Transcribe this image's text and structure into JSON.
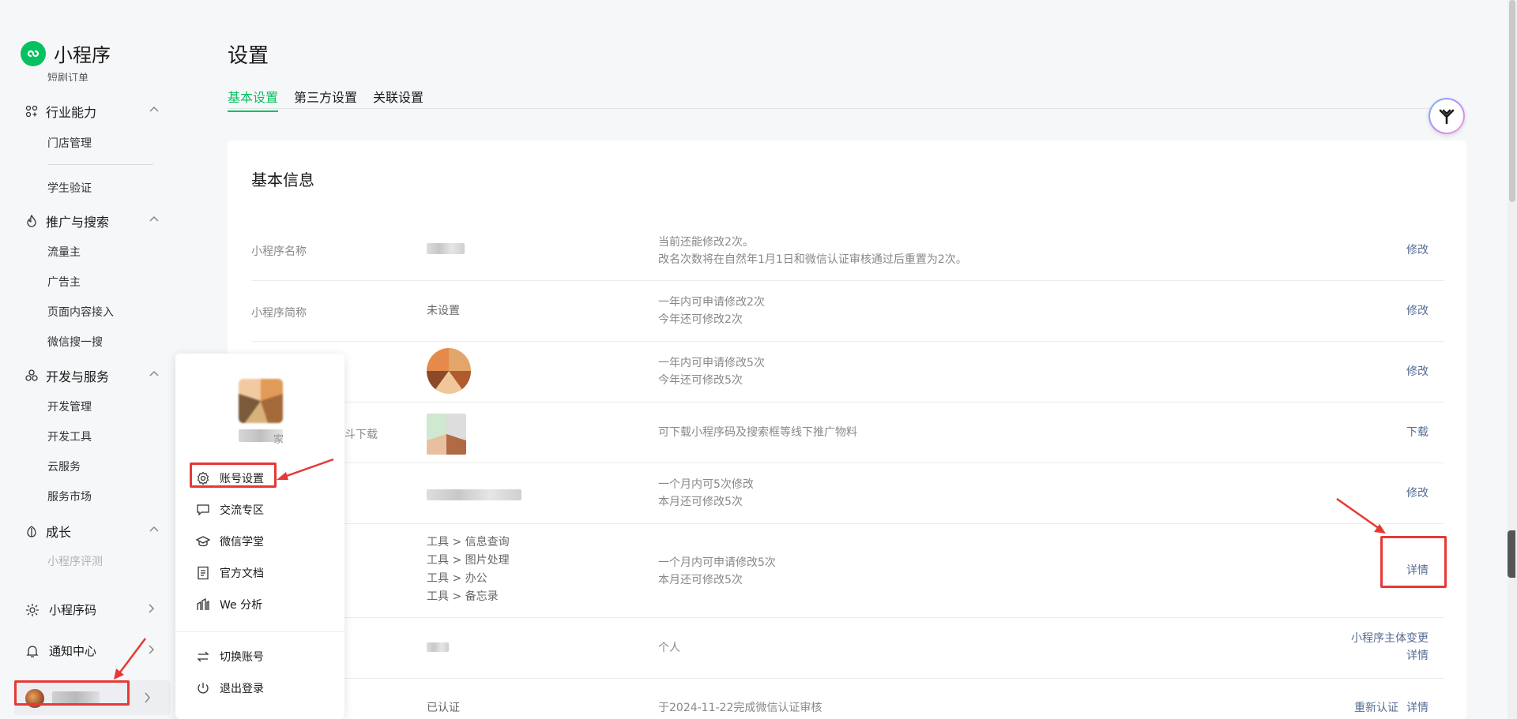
{
  "app": {
    "name": "小程序",
    "brand_color": "#07c160",
    "link_color": "#576b95",
    "alert_color": "#e53935"
  },
  "sidebar": {
    "cut_item": "短剧订单",
    "groups": [
      {
        "label": "行业能力",
        "icon": "industry-icon",
        "items": [
          "门店管理",
          "学生验证"
        ]
      },
      {
        "label": "推广与搜索",
        "icon": "flame-icon",
        "items": [
          "流量主",
          "广告主",
          "页面内容接入",
          "微信搜一搜"
        ]
      },
      {
        "label": "开发与服务",
        "icon": "cluster-icon",
        "items": [
          "开发管理",
          "开发工具",
          "云服务",
          "服务市场"
        ]
      },
      {
        "label": "成长",
        "icon": "leaf-icon",
        "items": [
          "小程序评测"
        ]
      }
    ],
    "rows": [
      {
        "label": "小程序码",
        "icon": "sun-icon"
      },
      {
        "label": "通知中心",
        "icon": "bell-icon"
      }
    ]
  },
  "page": {
    "title": "设置",
    "tabs": [
      "基本设置",
      "第三方设置",
      "关联设置"
    ]
  },
  "basic_info": {
    "title": "基本信息",
    "rows": [
      {
        "label": "小程序名称",
        "desc": [
          "当前还能修改2次。",
          "改名次数将在自然年1月1日和微信认证审核通过后重置为2次。"
        ],
        "action": "修改"
      },
      {
        "label": "小程序简称",
        "value": "未设置",
        "desc": [
          "一年内可申请修改2次",
          "今年还可修改2次"
        ],
        "action": "修改"
      },
      {
        "desc": [
          "一年内可申请修改5次",
          "今年还可修改5次"
        ],
        "action": "修改"
      },
      {
        "label_partial": "斗下载",
        "desc": [
          "可下载小程序码及搜索框等线下推广物料"
        ],
        "action": "下载"
      },
      {
        "desc": [
          "一个月内可5次修改",
          "本月还可修改5次"
        ],
        "action": "修改"
      },
      {
        "categories": [
          "工具 > 信息查询",
          "工具 > 图片处理",
          "工具 > 办公",
          "工具 > 备忘录"
        ],
        "desc": [
          "一个月内可申请修改5次",
          "本月还可修改5次"
        ],
        "action": "详情"
      },
      {
        "desc": [
          "个人"
        ],
        "actions": [
          "小程序主体变更",
          "详情"
        ]
      },
      {
        "value": "已认证",
        "desc": [
          "于2024-11-22完成微信认证审核"
        ],
        "actions": [
          "重新认证",
          "详情"
        ]
      }
    ]
  },
  "account_popup": {
    "name_partial": "家",
    "items": [
      {
        "label": "账号设置",
        "icon": "gear-icon"
      },
      {
        "label": "交流专区",
        "icon": "chat-icon"
      },
      {
        "label": "微信学堂",
        "icon": "graduation-cap-icon"
      },
      {
        "label": "官方文档",
        "icon": "document-icon"
      },
      {
        "label": "We 分析",
        "icon": "analytics-icon"
      },
      {
        "label": "切换账号",
        "icon": "switch-icon"
      },
      {
        "label": "退出登录",
        "icon": "power-icon"
      }
    ]
  }
}
